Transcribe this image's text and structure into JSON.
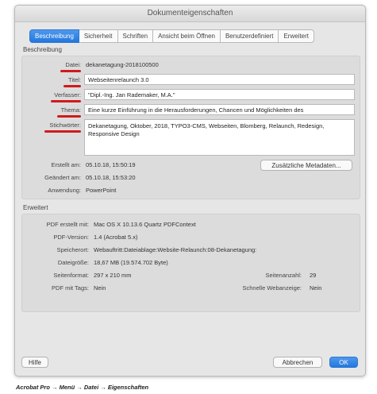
{
  "window": {
    "title": "Dokumenteigenschaften"
  },
  "tabs": [
    {
      "label": "Beschreibung",
      "active": true
    },
    {
      "label": "Sicherheit"
    },
    {
      "label": "Schriften"
    },
    {
      "label": "Ansicht beim Öffnen"
    },
    {
      "label": "Benutzerdefiniert"
    },
    {
      "label": "Erweitert"
    }
  ],
  "beschreibung": {
    "heading": "Beschreibung",
    "datei_label": "Datei:",
    "datei_value": "dekanetagung-2018100500",
    "titel_label": "Titel:",
    "titel_value": "Webseitenrelaunch 3.0",
    "verfasser_label": "Verfasser:",
    "verfasser_value": "\"Dipl.-Ing. Jan Rademaker, M.A.\"",
    "thema_label": "Thema:",
    "thema_value": "Eine kurze Einführung in die Herausforderungen, Chancen und Möglichkeiten des",
    "stichwoerter_label": "Stichwörter:",
    "stichwoerter_value": "Dekanetagung, Oktober, 2018, TYPO3-CMS, Webseiten, Blomberg, Relaunch, Redesign, Responsive Design",
    "erstellt_label": "Erstellt am:",
    "erstellt_value": "05.10.18, 15:50:19",
    "geaendert_label": "Geändert am:",
    "geaendert_value": "05.10.18, 15:53:20",
    "anwendung_label": "Anwendung:",
    "anwendung_value": "PowerPoint",
    "metadata_button": "Zusätzliche Metadaten..."
  },
  "erweitert": {
    "heading": "Erweitert",
    "pdf_erstellt_label": "PDF erstellt mit:",
    "pdf_erstellt_value": "Mac OS X 10.13.6 Quartz PDFContext",
    "pdf_version_label": "PDF-Version:",
    "pdf_version_value": "1.4 (Acrobat 5.x)",
    "speicherort_label": "Speicherort:",
    "speicherort_value": "Webauftritt:Dateiablage:Website-Relaunch:08-Dekanetagung:",
    "dateigroesse_label": "Dateigröße:",
    "dateigroesse_value": "18,67 MB (19.574.702 Byte)",
    "seitenformat_label": "Seitenformat:",
    "seitenformat_value": "297 x 210 mm",
    "seitenanzahl_label": "Seitenanzahl:",
    "seitenanzahl_value": "29",
    "tags_label": "PDF mit Tags:",
    "tags_value": "Nein",
    "webanzeige_label": "Schnelle Webanzeige:",
    "webanzeige_value": "Nein"
  },
  "footer": {
    "help": "Hilfe",
    "cancel": "Abbrechen",
    "ok": "OK"
  },
  "caption": "Acrobat Pro → Menü → Datei → Eigenschaften",
  "colors": {
    "accent": "#2277de",
    "highlight": "#d11a1a"
  }
}
